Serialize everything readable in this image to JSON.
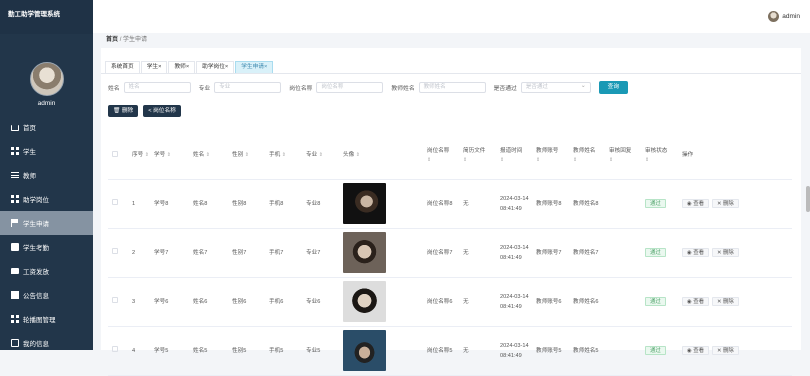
{
  "sidebar": {
    "brand": "勤工助学管理系统",
    "user": "admin",
    "items": [
      {
        "label": "首页",
        "icon": "home-icon"
      },
      {
        "label": "学生",
        "icon": "grid-icon"
      },
      {
        "label": "教师",
        "icon": "list-icon"
      },
      {
        "label": "助学岗位",
        "icon": "grid-icon"
      },
      {
        "label": "学生申请",
        "icon": "flag-icon",
        "active": true
      },
      {
        "label": "学生考勤",
        "icon": "clipboard-icon"
      },
      {
        "label": "工资发放",
        "icon": "message-icon"
      },
      {
        "label": "公告信息",
        "icon": "chart-icon"
      },
      {
        "label": "轮播图管理",
        "icon": "grid-icon"
      },
      {
        "label": "我的信息",
        "icon": "window-icon"
      }
    ]
  },
  "topbar": {
    "user": "admin"
  },
  "breadcrumb": {
    "home": "首页",
    "sep": "/",
    "current": "学生申请"
  },
  "tabs": [
    "系统首页",
    "学生×",
    "教师×",
    "助学岗位×",
    "学生申请×"
  ],
  "filters": {
    "name_label": "姓名",
    "name_placeholder": "姓名",
    "major_label": "专业",
    "major_placeholder": "专业",
    "post_label": "岗位名称",
    "post_placeholder": "岗位名称",
    "teacher_label": "教师姓名",
    "teacher_placeholder": "教师姓名",
    "pass_label": "是否通过",
    "pass_placeholder": "是否通过",
    "search_label": "查询"
  },
  "actions": {
    "delete": "删除",
    "post_stat": "岗位名称"
  },
  "table": {
    "headers": [
      "序号",
      "学号",
      "姓名",
      "性别",
      "手机",
      "专业",
      "头像",
      "岗位名称",
      "简历文件",
      "报道时间",
      "教师账号",
      "教师姓名",
      "审核回复",
      "审核状态",
      "操作"
    ],
    "sort_mark": "⇕",
    "rows": [
      {
        "no": "1",
        "sid": "学号8",
        "name": "姓名8",
        "gender": "性别8",
        "phone": "手机8",
        "major": "专业8",
        "photo": "p1",
        "post": "岗位名称8",
        "resume": "无",
        "time": "2024-03-14 08:41:49",
        "tacct": "教师账号8",
        "tname": "教师姓名8",
        "reply": "",
        "status": "通过",
        "view": "查看",
        "del": "删除"
      },
      {
        "no": "2",
        "sid": "学号7",
        "name": "姓名7",
        "gender": "性别7",
        "phone": "手机7",
        "major": "专业7",
        "photo": "p2",
        "post": "岗位名称7",
        "resume": "无",
        "time": "2024-03-14 08:41:49",
        "tacct": "教师账号7",
        "tname": "教师姓名7",
        "reply": "",
        "status": "通过",
        "view": "查看",
        "del": "删除"
      },
      {
        "no": "3",
        "sid": "学号6",
        "name": "姓名6",
        "gender": "性别6",
        "phone": "手机6",
        "major": "专业6",
        "photo": "p3",
        "post": "岗位名称6",
        "resume": "无",
        "time": "2024-03-14 08:41:49",
        "tacct": "教师账号6",
        "tname": "教师姓名6",
        "reply": "",
        "status": "通过",
        "view": "查看",
        "del": "删除"
      },
      {
        "no": "4",
        "sid": "学号5",
        "name": "姓名5",
        "gender": "性别5",
        "phone": "手机5",
        "major": "专业5",
        "photo": "p4",
        "post": "岗位名称5",
        "resume": "无",
        "time": "2024-03-14 08:41:49",
        "tacct": "教师账号5",
        "tname": "教师姓名5",
        "reply": "",
        "status": "通过",
        "view": "查看",
        "del": "删除"
      }
    ]
  }
}
